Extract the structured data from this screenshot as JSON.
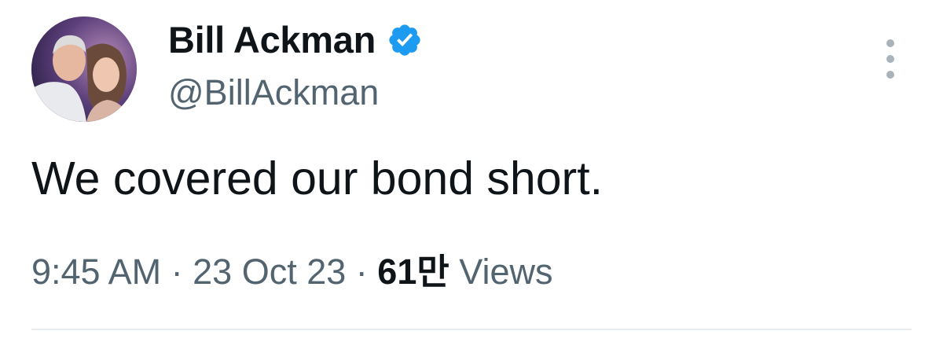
{
  "author": {
    "display_name": "Bill Ackman",
    "handle": "@BillAckman",
    "verified_icon": "verified-badge-icon",
    "avatar": "avatar-photo"
  },
  "tweet": {
    "text": "We covered our bond short."
  },
  "meta": {
    "time": "9:45 AM",
    "separator": "·",
    "date": "23 Oct 23",
    "views_count": "61만",
    "views_label": "Views"
  },
  "actions": {
    "more_icon": "more-options-icon"
  },
  "colors": {
    "text_primary": "#0f1419",
    "text_secondary": "#536471",
    "verified_blue": "#1d9bf0",
    "divider": "#e7ecf0"
  }
}
